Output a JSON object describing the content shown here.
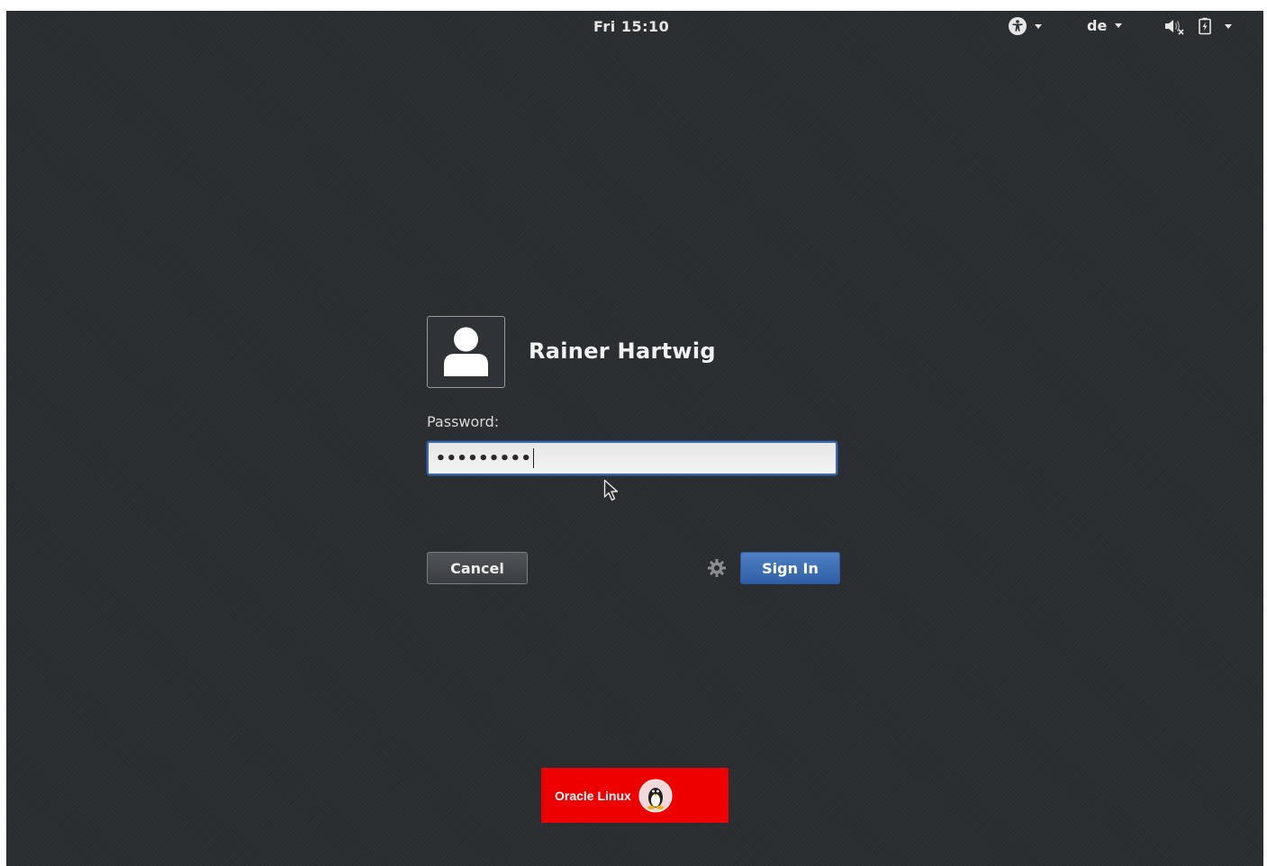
{
  "top_bar": {
    "clock": "Fri 15:10",
    "accessibility_icon": "accessibility-icon",
    "keyboard_layout": "de",
    "volume_icon": "speaker-muted-icon",
    "battery_icon": "battery-charging-icon"
  },
  "login": {
    "user_name": "Rainer Hartwig",
    "avatar_icon": "user-avatar-icon",
    "password_label": "Password:",
    "password_mask": "•••••••••",
    "cancel_label": "Cancel",
    "session_icon": "gear-icon",
    "sign_in_label": "Sign In"
  },
  "branding": {
    "logo_text": "Oracle Linux",
    "logo_color": "#ee0000"
  },
  "colors": {
    "background": "#2b2e31",
    "accent_blue": "#3e68a8"
  }
}
